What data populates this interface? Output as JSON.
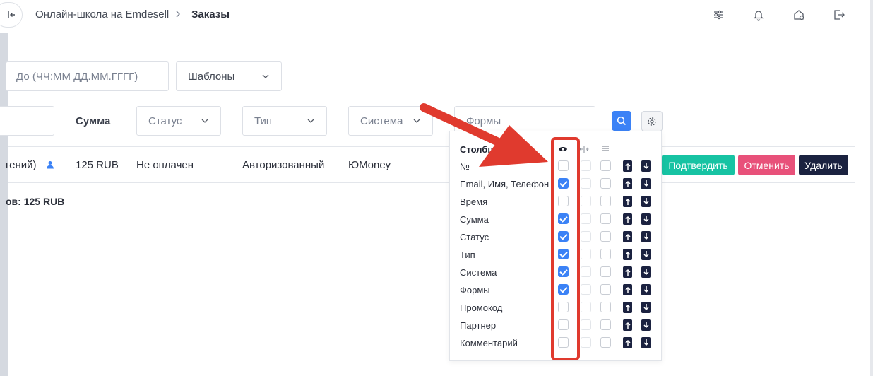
{
  "breadcrumb": {
    "root": "Онлайн-школа на Emdesell",
    "current": "Заказы"
  },
  "filters": {
    "date_to_placeholder": "До (ЧЧ:ММ ДД.ММ.ГГГГ)",
    "templates_label": "Шаблоны",
    "sum_label": "Сумма",
    "status_label": "Статус",
    "type_label": "Тип",
    "system_label": "Система",
    "forms_placeholder": "Формы"
  },
  "order_row": {
    "client": "гений)",
    "sum": "125 RUB",
    "status": "Не оплачен",
    "type": "Авторизованный",
    "system": "ЮMoney",
    "confirm": "Подтвердить",
    "cancel": "Отменить",
    "delete": "Удалить"
  },
  "total_text": "ов: 125 RUB",
  "columns_panel": {
    "title": "Столбцы",
    "rows": [
      {
        "label": "№",
        "visible": false
      },
      {
        "label": "Email, Имя, Телефон",
        "visible": true
      },
      {
        "label": "Время",
        "visible": false
      },
      {
        "label": "Сумма",
        "visible": true
      },
      {
        "label": "Статус",
        "visible": true
      },
      {
        "label": "Тип",
        "visible": true
      },
      {
        "label": "Система",
        "visible": true
      },
      {
        "label": "Формы",
        "visible": true
      },
      {
        "label": "Промокод",
        "visible": false
      },
      {
        "label": "Партнер",
        "visible": false
      },
      {
        "label": "Комментарий",
        "visible": false
      }
    ]
  },
  "colors": {
    "accent": "#3b82f6",
    "confirm": "#17c3a3",
    "cancel": "#e8517a",
    "delete": "#1b2240",
    "annotation": "#e03a2e"
  }
}
